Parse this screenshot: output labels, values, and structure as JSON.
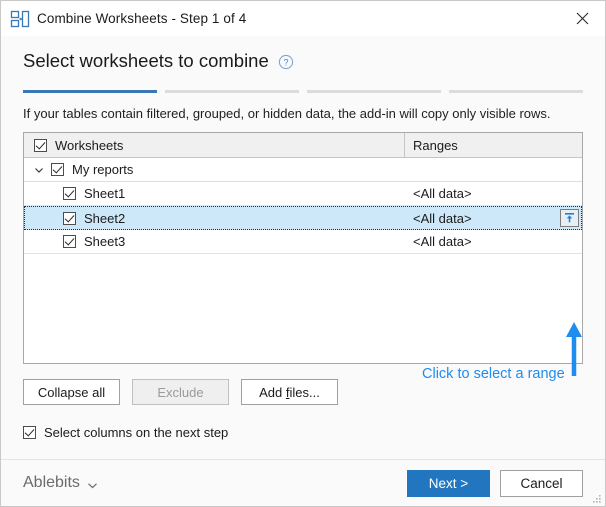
{
  "window": {
    "title": "Combine Worksheets - Step 1 of 4",
    "icon": "combine-worksheets-icon",
    "close_icon": "close-icon"
  },
  "header": {
    "heading": "Select worksheets to combine",
    "help_icon": "help-circle-icon",
    "steps": {
      "total": 4,
      "current": 1,
      "active_color": "#3a78b5",
      "inactive_color": "#dcdcdc"
    }
  },
  "main": {
    "note": "If your tables contain filtered, grouped, or hidden data, the add-in will copy only visible rows.",
    "table": {
      "columns": [
        {
          "key": "worksheets",
          "label": "Worksheets",
          "header_checkbox_checked": true
        },
        {
          "key": "ranges",
          "label": "Ranges"
        }
      ],
      "rows": [
        {
          "type": "group",
          "label": "My reports",
          "checked": true,
          "expanded": true,
          "chevron_icon": "chevron-down-icon",
          "range": "",
          "selected": false,
          "has_range_button": false
        },
        {
          "type": "child",
          "label": "Sheet1",
          "checked": true,
          "range": "<All data>",
          "selected": false,
          "has_range_button": false
        },
        {
          "type": "child",
          "label": "Sheet2",
          "checked": true,
          "range": "<All data>",
          "selected": true,
          "has_range_button": true,
          "range_button_icon": "select-range-icon"
        },
        {
          "type": "child",
          "label": "Sheet3",
          "checked": true,
          "range": "<All data>",
          "selected": false,
          "has_range_button": false
        }
      ]
    },
    "annotation": {
      "text": "Click to select a range",
      "color": "#1f8cf0",
      "arrow_icon": "up-arrow-annotation-icon"
    },
    "buttons": [
      {
        "key": "collapse_all",
        "label": "Collapse all",
        "disabled": false,
        "accel": ""
      },
      {
        "key": "exclude",
        "label": "Exclude",
        "disabled": true,
        "accel": ""
      },
      {
        "key": "add_files",
        "label": "Add files...",
        "disabled": false,
        "accel": "f"
      }
    ],
    "option": {
      "label": "Select columns on the next step",
      "checked": true
    }
  },
  "footer": {
    "brand": "Ablebits",
    "brand_caret_icon": "chevron-down-icon",
    "next_label": "Next >",
    "next_color": "#2276bf",
    "cancel_label": "Cancel",
    "resize_grip_icon": "resize-grip-icon"
  }
}
